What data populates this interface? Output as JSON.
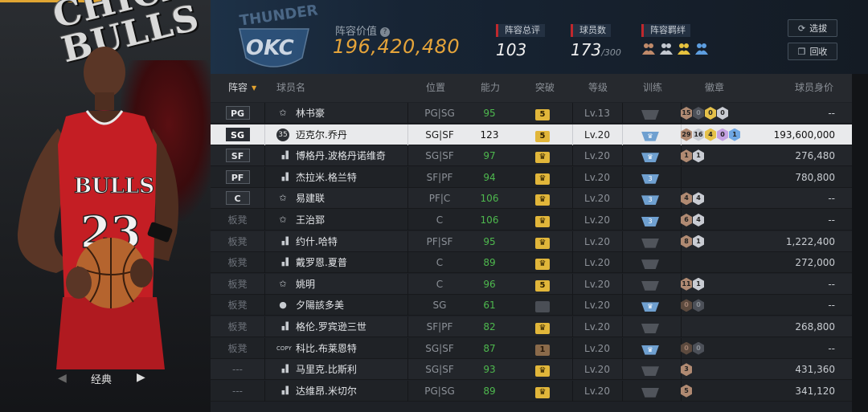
{
  "sidebar": {
    "team_word": "CHICAGO BULLS",
    "nav_label": "经典",
    "prev_icon": "triangle-left-icon",
    "next_icon": "triangle-right-icon"
  },
  "header": {
    "logo_text": "OKC",
    "logo_sub": "THUNDER",
    "lineup_value_label": "阵容价值",
    "lineup_value": "196,420,480",
    "rating_label": "阵容总评",
    "rating_value": "103",
    "players_label": "球员数",
    "players_value": "173",
    "players_max": "/300",
    "bonds_label": "阵容羁绊",
    "select_button": "选拔",
    "recycle_button": "回收"
  },
  "table": {
    "columns": [
      "阵容",
      "球员名",
      "位置",
      "能力",
      "突破",
      "等级",
      "训练",
      "徽章",
      "球员身价"
    ],
    "rows": [
      {
        "slot": "PG",
        "starter": true,
        "type_icon": "star-icon",
        "name": "林书豪",
        "position": "PG|SG",
        "ability": "95",
        "breakthrough": "5",
        "bt_style": "gold-num",
        "level": "Lv.13",
        "training": "",
        "tr_style": "grey",
        "badges": [
          [
            "15",
            "bronze"
          ],
          [
            "0",
            "dark"
          ],
          [
            "0",
            "gold"
          ],
          [
            "0",
            "silver"
          ]
        ],
        "price": "--"
      },
      {
        "slot": "SG",
        "starter": true,
        "selected": true,
        "type_icon": "legend-35-icon",
        "name": "迈克尔.乔丹",
        "position": "SG|SF",
        "ability": "123",
        "breakthrough": "5",
        "bt_style": "gold-num",
        "level": "Lv.20",
        "training": "",
        "tr_style": "blue-crown",
        "badges": [
          [
            "29",
            "bronze"
          ],
          [
            "16",
            "silver"
          ],
          [
            "4",
            "gold"
          ],
          [
            "0",
            "purple"
          ],
          [
            "1",
            "blue"
          ]
        ],
        "price": "193,600,000"
      },
      {
        "slot": "SF",
        "starter": true,
        "type_icon": "signal-icon",
        "name": "博格丹.波格丹诺维奇",
        "position": "SG|SF",
        "ability": "97",
        "breakthrough": "",
        "bt_style": "gold-crown",
        "level": "Lv.20",
        "training": "",
        "tr_style": "blue-crown",
        "badges": [
          [
            "1",
            "bronze"
          ],
          [
            "1",
            "silver"
          ]
        ],
        "price": "276,480"
      },
      {
        "slot": "PF",
        "starter": true,
        "type_icon": "signal-icon",
        "name": "杰拉米.格兰特",
        "position": "SF|PF",
        "ability": "94",
        "breakthrough": "",
        "bt_style": "gold-crown",
        "level": "Lv.20",
        "training": "3",
        "tr_style": "blue-num",
        "badges": [],
        "price": "780,800"
      },
      {
        "slot": "C",
        "starter": true,
        "type_icon": "star-icon",
        "name": "易建联",
        "position": "PF|C",
        "ability": "106",
        "breakthrough": "",
        "bt_style": "gold-crown",
        "level": "Lv.20",
        "training": "3",
        "tr_style": "blue-num",
        "badges": [
          [
            "4",
            "bronze"
          ],
          [
            "4",
            "silver"
          ]
        ],
        "price": "--"
      },
      {
        "slot": "板凳",
        "starter": false,
        "type_icon": "star-icon",
        "name": "王治郅",
        "position": "C",
        "ability": "106",
        "breakthrough": "",
        "bt_style": "gold-crown",
        "level": "Lv.20",
        "training": "3",
        "tr_style": "blue-num",
        "badges": [
          [
            "6",
            "bronze"
          ],
          [
            "4",
            "silver"
          ]
        ],
        "price": "--"
      },
      {
        "slot": "板凳",
        "starter": false,
        "type_icon": "signal-icon",
        "name": "约什.哈特",
        "position": "PF|SF",
        "ability": "95",
        "breakthrough": "",
        "bt_style": "gold-crown",
        "level": "Lv.20",
        "training": "",
        "tr_style": "grey",
        "badges": [
          [
            "8",
            "bronze"
          ],
          [
            "1",
            "silver"
          ]
        ],
        "price": "1,222,400"
      },
      {
        "slot": "板凳",
        "starter": false,
        "type_icon": "signal-icon",
        "name": "戴罗恩.夏普",
        "position": "C",
        "ability": "89",
        "breakthrough": "",
        "bt_style": "gold-crown",
        "level": "Lv.20",
        "training": "",
        "tr_style": "grey",
        "badges": [],
        "price": "272,000"
      },
      {
        "slot": "板凳",
        "starter": false,
        "type_icon": "star-icon",
        "name": "姚明",
        "position": "C",
        "ability": "96",
        "breakthrough": "5",
        "bt_style": "gold-num",
        "level": "Lv.20",
        "training": "",
        "tr_style": "grey",
        "badges": [
          [
            "11",
            "bronze"
          ],
          [
            "1",
            "silver"
          ]
        ],
        "price": "--"
      },
      {
        "slot": "板凳",
        "starter": false,
        "type_icon": "person-icon",
        "name": "夕陽該多美",
        "position": "SG",
        "ability": "61",
        "breakthrough": "",
        "bt_style": "grey",
        "level": "Lv.20",
        "training": "",
        "tr_style": "blue-crown",
        "badges": [
          [
            "0",
            "darkbr"
          ],
          [
            "0",
            "dark"
          ]
        ],
        "price": "--"
      },
      {
        "slot": "板凳",
        "starter": false,
        "type_icon": "signal-icon",
        "name": "格伦.罗宾逊三世",
        "position": "SF|PF",
        "ability": "82",
        "breakthrough": "",
        "bt_style": "gold-crown",
        "level": "Lv.20",
        "training": "",
        "tr_style": "grey",
        "badges": [],
        "price": "268,800"
      },
      {
        "slot": "板凳",
        "starter": false,
        "type_icon": "copy-icon",
        "name": "科比.布莱恩特",
        "position": "SG|SF",
        "ability": "87",
        "breakthrough": "1",
        "bt_style": "brown-num",
        "level": "Lv.20",
        "training": "",
        "tr_style": "blue-crown",
        "badges": [
          [
            "0",
            "darkbr"
          ],
          [
            "0",
            "dark"
          ]
        ],
        "price": "--"
      },
      {
        "slot": "---",
        "starter": false,
        "type_icon": "signal-icon",
        "name": "马里克.比斯利",
        "position": "SG|SF",
        "ability": "93",
        "breakthrough": "",
        "bt_style": "gold-crown",
        "level": "Lv.20",
        "training": "",
        "tr_style": "grey",
        "badges": [
          [
            "3",
            "bronze"
          ]
        ],
        "price": "431,360"
      },
      {
        "slot": "---",
        "starter": false,
        "type_icon": "signal-icon",
        "name": "达维昂.米切尔",
        "position": "PG|SG",
        "ability": "89",
        "breakthrough": "",
        "bt_style": "gold-crown",
        "level": "Lv.20",
        "training": "",
        "tr_style": "grey",
        "badges": [
          [
            "5",
            "bronze"
          ]
        ],
        "price": "341,120"
      }
    ]
  },
  "colors": {
    "accent": "#e5a43a",
    "ability_green": "#4eb94e",
    "stat_red": "#c0282d"
  }
}
